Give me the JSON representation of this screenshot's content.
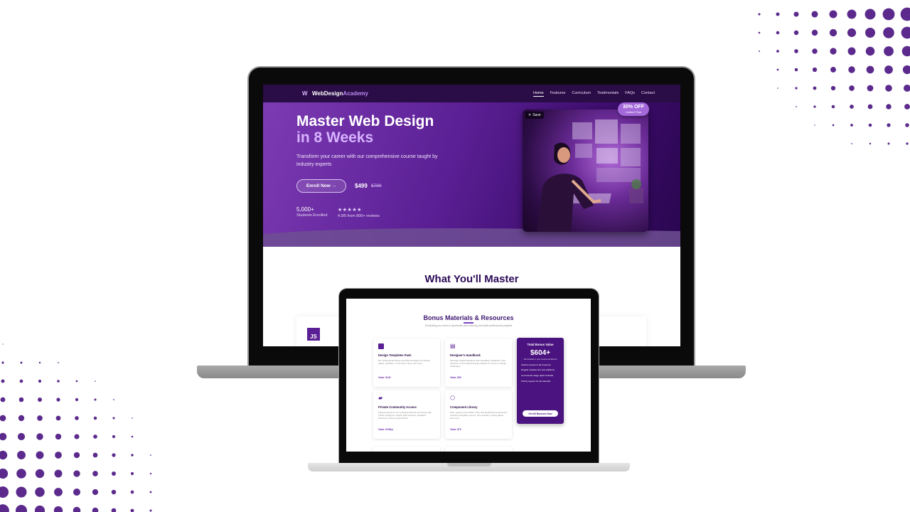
{
  "site": {
    "logo_name": "WebDesign",
    "logo_accent": "Academy",
    "nav": [
      {
        "label": "Home"
      },
      {
        "label": "Features"
      },
      {
        "label": "Curriculum"
      },
      {
        "label": "Testimonials"
      },
      {
        "label": "FAQs"
      },
      {
        "label": "Contact"
      }
    ],
    "hero": {
      "title_line1": "Master Web Design",
      "title_line2": "in 8 Weeks",
      "subtitle": "Transform your career with our comprehensive course taught by industry experts",
      "cta": "Enroll Now →",
      "price": "$499",
      "price_old": "$799",
      "stat_students": "5,000+",
      "stat_students_label": "Students Enrolled",
      "stars": "★★★★★",
      "rating_label": "4.9/5 from 800+ reviews",
      "save_label": "Save",
      "badge_main": "30% OFF",
      "badge_sub": "Limited Time"
    },
    "section_title": "What You'll Master",
    "feature_icon_text": "JS"
  },
  "bonus": {
    "title": "Bonus Materials & Resources",
    "subtitle": "Everything you need to accelerate your learning and build professional projects",
    "cards": [
      {
        "icon": "psd-file-icon",
        "name": "Design Templates Pack",
        "desc": "50+ professional Figma and PSD templates for landing pages, portfolios, e-commerce sites, and more.",
        "value": "Value: $149"
      },
      {
        "icon": "book-icon",
        "name": "Designer's Handbook",
        "desc": "200-page digital handbook with checklists, guidelines, best practices, and troubleshooting solutions for common design challenges.",
        "value": "Value: $99"
      },
      {
        "icon": "chat-icon",
        "name": "Private Community Access",
        "desc": "Lifetime access to our exclusive Discord community with 5,000+ designers, weekly Q&A sessions, feedback channels, and job opportunities.",
        "value": "Value: $199/yr"
      },
      {
        "icon": "component-icon",
        "name": "Component Library",
        "desc": "150+ ready-to-use HTML, CSS, and JavaScript components including navigation menus, hero sections, pricing tables, and more.",
        "value": "Value: $79"
      }
    ],
    "total": {
      "title": "Total Bonus Value",
      "amount": "$604+",
      "note": "All included in your course enrollment",
      "items": [
        "Lifetime access to all resources",
        "Regular updates and new additions",
        "Commercial usage rights included",
        "Priority support for all materials"
      ],
      "cta": "Get All Bonuses Now"
    }
  },
  "colors": {
    "brand_purple": "#5a1f94",
    "dot_purple": "#5b2a8c"
  }
}
